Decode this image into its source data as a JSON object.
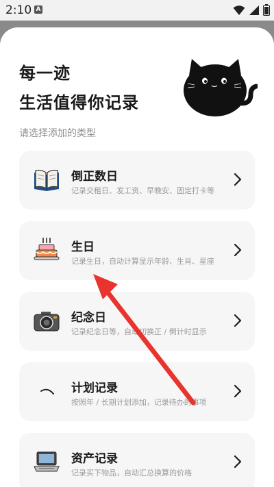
{
  "status_bar": {
    "time": "2:10",
    "notification_letter": "A",
    "icons": [
      "wifi-icon",
      "signal-icon",
      "battery-icon"
    ]
  },
  "header": {
    "line1": "每一迹",
    "line2": "生活值得你记录",
    "subtitle": "请选择添加的类型"
  },
  "cards": [
    {
      "title": "倒正数日",
      "desc": "记录交租日、发工资、早晚安、固定打卡等",
      "icon": "open-book-icon"
    },
    {
      "title": "生日",
      "desc": "记录生日，自动计算显示年龄、生肖、星座",
      "icon": "birthday-cake-icon"
    },
    {
      "title": "纪念日",
      "desc": "记录纪念日等，自动切换正 / 倒计时显示",
      "icon": "camera-icon"
    },
    {
      "title": "计划记录",
      "desc": "按照年 / 长期计划添加，记录待办的事项",
      "icon": "plan-icon"
    },
    {
      "title": "资产记录",
      "desc": "记录买下物品，自动汇总换算的价格",
      "icon": "laptop-icon"
    }
  ],
  "colors": {
    "annotation_arrow": "#e8332f",
    "card_background": "#f6f6f6",
    "title_text": "#1a1a1a",
    "desc_text": "#9a9a9a"
  }
}
